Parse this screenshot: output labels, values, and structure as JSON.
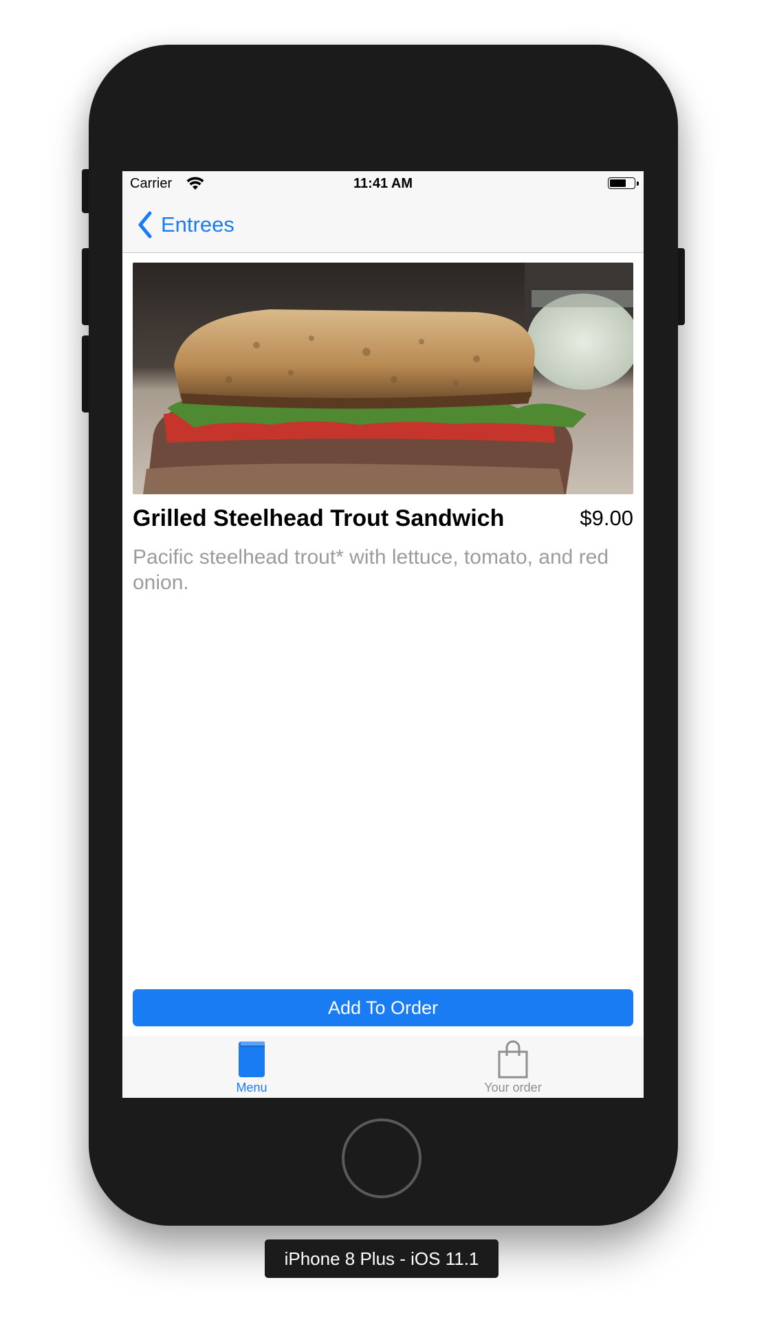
{
  "status_bar": {
    "carrier": "Carrier",
    "time": "11:41 AM",
    "battery_level": 0.6
  },
  "nav": {
    "back_label": "Entrees"
  },
  "item": {
    "name": "Grilled Steelhead Trout Sandwich",
    "price": "$9.00",
    "description": "Pacific steelhead trout* with lettuce, tomato, and red onion."
  },
  "actions": {
    "add_to_order_label": "Add To Order"
  },
  "tab_bar": {
    "tabs": [
      {
        "label": "Menu",
        "icon": "book-icon",
        "selected": true
      },
      {
        "label": "Your order",
        "icon": "shopping-bag-icon",
        "selected": false
      }
    ]
  },
  "simulator": {
    "device_label": "iPhone 8 Plus - iOS 11.1"
  },
  "colors": {
    "accent": "#1a7cf3",
    "device_body": "#1b1b1b",
    "secondary_text": "#9b9b9b",
    "inactive_tab": "#8e8e93"
  }
}
